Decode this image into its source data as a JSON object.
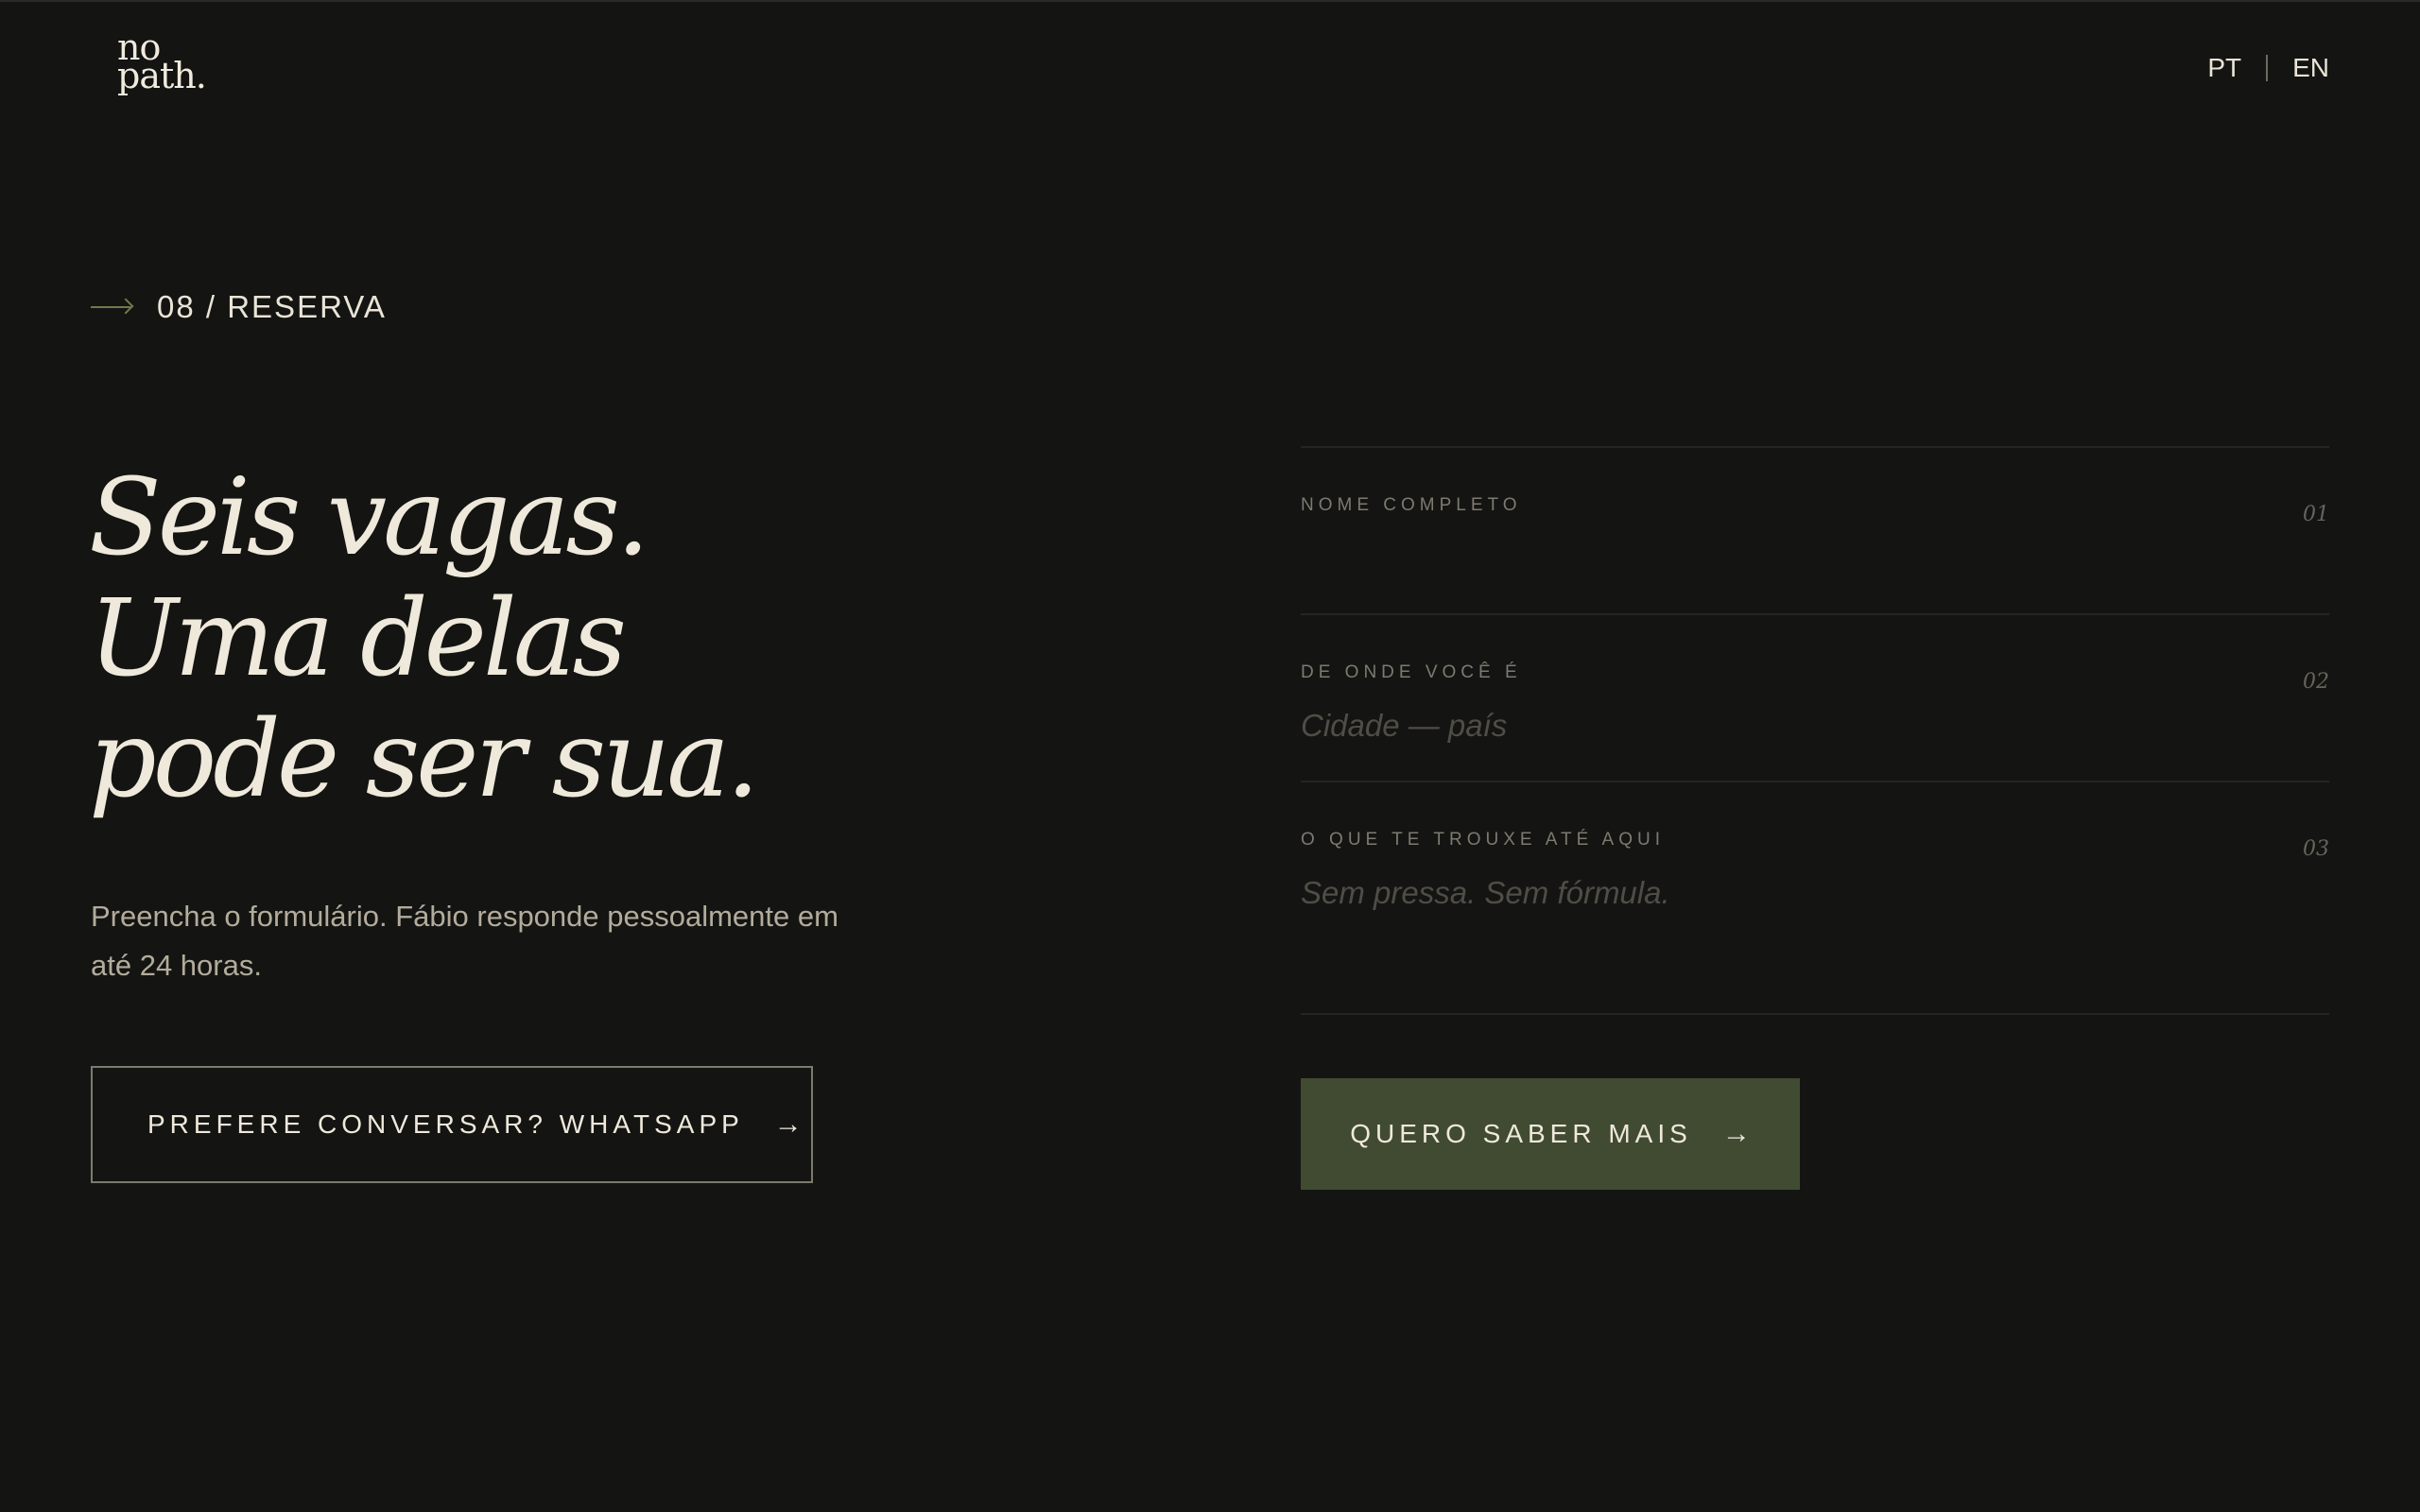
{
  "brand": {
    "logo_line1": "no",
    "logo_line2": "path",
    "logo_dot": "."
  },
  "lang": {
    "pt": "PT",
    "en": "EN"
  },
  "section": {
    "eyebrow": "08 / RESERVA"
  },
  "hero": {
    "line1": "Seis vagas.",
    "line2": "Uma delas",
    "line3": "pode ser sua.",
    "lead": "Preencha o formulário. Fábio responde pessoalmente em até 24 horas.",
    "whatsapp_label": "PREFERE CONVERSAR? WHATSAPP",
    "arrow": "→"
  },
  "form": {
    "fields": [
      {
        "label": "NOME COMPLETO",
        "number": "01",
        "placeholder": "",
        "value": ""
      },
      {
        "label": "DE ONDE VOCÊ É",
        "number": "02",
        "placeholder": "Cidade — país",
        "value": ""
      },
      {
        "label": "O QUE TE TROUXE ATÉ AQUI",
        "number": "03",
        "placeholder": "Sem pressa. Sem fórmula.",
        "value": ""
      }
    ],
    "submit_label": "QUERO SABER MAIS",
    "submit_arrow": "→"
  },
  "colors": {
    "background": "#141412",
    "text": "#efe9db",
    "muted": "#b3ac9c",
    "accent": "#414b32",
    "arrow_accent": "#6f7a4c"
  }
}
